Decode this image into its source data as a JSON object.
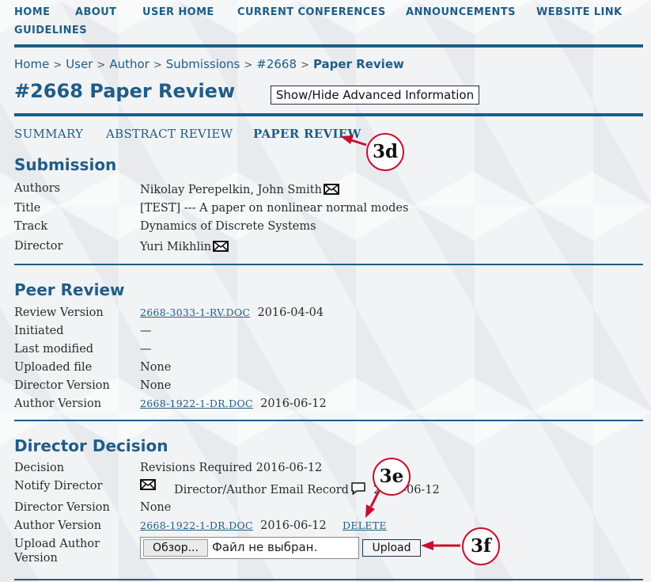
{
  "nav": {
    "home": "HOME",
    "about": "ABOUT",
    "user_home": "USER HOME",
    "current_conferences": "CURRENT CONFERENCES",
    "announcements": "ANNOUNCEMENTS",
    "website_link": "WEBSITE LINK",
    "guidelines": "GUIDELINES"
  },
  "breadcrumb": [
    "Home",
    "User",
    "Author",
    "Submissions",
    "#2668",
    "Paper Review"
  ],
  "page": {
    "title": "#2668 Paper Review",
    "advanced_button": "Show/Hide Advanced Information"
  },
  "tabs": {
    "summary": "SUMMARY",
    "abstract": "ABSTRACT REVIEW",
    "paper": "PAPER REVIEW"
  },
  "submission": {
    "heading": "Submission",
    "authors_label": "Authors",
    "authors": "Nikolay Perepelkin, John Smith",
    "title_label": "Title",
    "title": "[TEST] --- A paper on nonlinear normal modes",
    "track_label": "Track",
    "track": "Dynamics of Discrete Systems",
    "director_label": "Director",
    "director": "Yuri Mikhlin"
  },
  "peer_review": {
    "heading": "Peer Review",
    "review_version_label": "Review Version",
    "review_version_file": "2668-3033-1-RV.DOC",
    "review_version_date": "2016-04-04",
    "initiated_label": "Initiated",
    "initiated": "—",
    "last_modified_label": "Last modified",
    "last_modified": "—",
    "uploaded_file_label": "Uploaded file",
    "uploaded_file": "None",
    "director_version_label": "Director Version",
    "director_version": "None",
    "author_version_label": "Author Version",
    "author_version_file": "2668-1922-1-DR.DOC",
    "author_version_date": "2016-06-12"
  },
  "director_decision": {
    "heading": "Director Decision",
    "decision_label": "Decision",
    "decision": "Revisions Required 2016-06-12",
    "notify_label": "Notify Director",
    "email_record": "Director/Author Email Record",
    "email_record_date": "2016-06-12",
    "director_version_label": "Director Version",
    "director_version": "None",
    "author_version_label": "Author Version",
    "author_version_file": "2668-1922-1-DR.DOC",
    "author_version_date": "2016-06-12",
    "delete": "DELETE",
    "upload_label_line1": "Upload Author",
    "upload_label_line2": "Version",
    "browse_button": "Обзор...",
    "no_file": "Файл не выбран.",
    "upload_button": "Upload"
  },
  "callouts": {
    "paper_tab": "3d",
    "delete": "3e",
    "upload": "3f"
  },
  "colors": {
    "brand": "#1f5d86",
    "callout_red": "#c8102e"
  },
  "icons": [
    "envelope-icon",
    "speech-bubble-icon"
  ]
}
